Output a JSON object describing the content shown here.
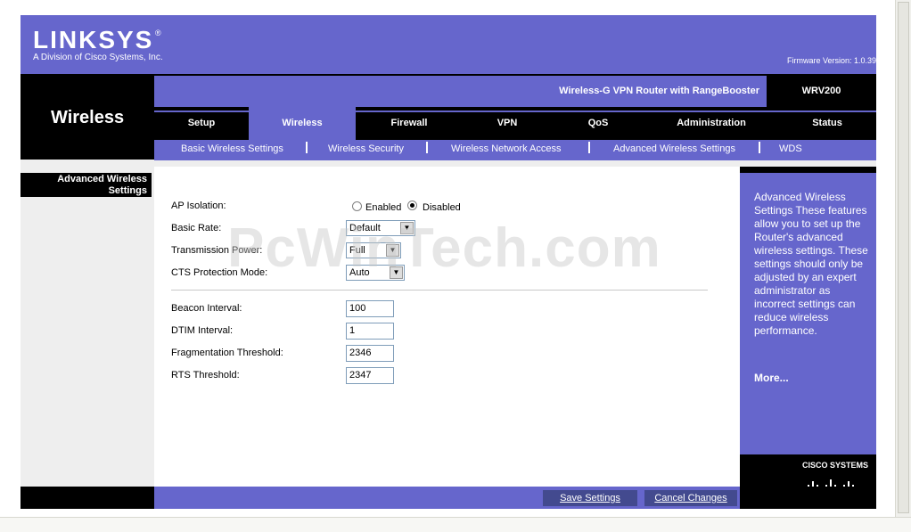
{
  "header": {
    "logo": "LINKSYS",
    "logo_reg": "®",
    "logo_sub": "A Division of Cisco Systems, Inc.",
    "firmware": "Firmware Version: 1.0.39"
  },
  "section_title": "Wireless",
  "product": {
    "name": "Wireless-G VPN Router with RangeBooster",
    "model": "WRV200"
  },
  "tabs": [
    {
      "label": "Setup",
      "active": false
    },
    {
      "label": "Wireless",
      "active": true
    },
    {
      "label": "Firewall",
      "active": false
    },
    {
      "label": "VPN",
      "active": false
    },
    {
      "label": "QoS",
      "active": false
    },
    {
      "label": "Administration",
      "active": false
    },
    {
      "label": "Status",
      "active": false
    }
  ],
  "subtabs": [
    {
      "label": "Basic Wireless Settings"
    },
    {
      "label": "Wireless Security"
    },
    {
      "label": "Wireless Network Access"
    },
    {
      "label": "Advanced Wireless Settings"
    },
    {
      "label": "WDS"
    }
  ],
  "left_label": "Advanced Wireless Settings",
  "form": {
    "ap_isolation": {
      "label": "AP Isolation:",
      "enabled_label": "Enabled",
      "disabled_label": "Disabled",
      "selected": "Disabled"
    },
    "basic_rate": {
      "label": "Basic Rate:",
      "value": "Default"
    },
    "transmission_power": {
      "label": "Transmission Power:",
      "value": "Full"
    },
    "cts_protection": {
      "label": "CTS Protection Mode:",
      "value": "Auto"
    },
    "beacon_interval": {
      "label": "Beacon Interval:",
      "value": "100"
    },
    "dtim_interval": {
      "label": "DTIM Interval:",
      "value": "1"
    },
    "fragmentation_threshold": {
      "label": "Fragmentation Threshold:",
      "value": "2346"
    },
    "rts_threshold": {
      "label": "RTS Threshold:",
      "value": "2347"
    }
  },
  "watermark": "PcWinTech.com",
  "help": {
    "text": "Advanced Wireless Settings These features allow you to set up the Router's advanced wireless settings. These settings should only be adjusted by an expert administrator as incorrect settings can reduce wireless performance.",
    "more": "More...",
    "cisco": "CISCO SYSTEMS"
  },
  "buttons": {
    "save": "Save Settings",
    "cancel": "Cancel Changes"
  },
  "colors": {
    "brand": "#6666cc",
    "dark": "#000000",
    "button": "#434a8f"
  }
}
